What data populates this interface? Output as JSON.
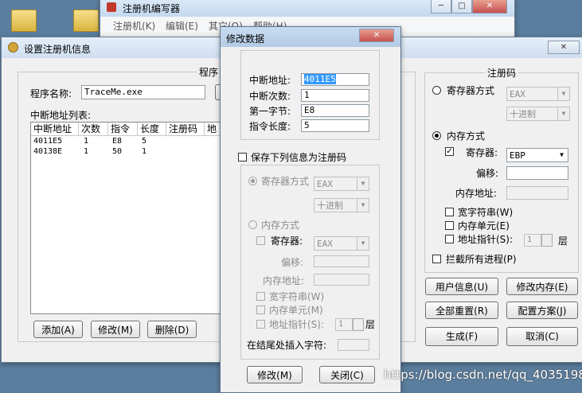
{
  "back_window": {
    "title": "注册机编写器",
    "menu": [
      "注册机(K)",
      "编辑(E)",
      "其它(O)",
      "帮助(H)"
    ]
  },
  "settings_window": {
    "title": "设置注册机信息",
    "program_group_label": "程序",
    "program_name_label": "程序名称:",
    "program_name_value": "TraceMe.exe",
    "breakpoint_list_label": "中断地址列表:",
    "table": {
      "headers": [
        "中断地址",
        "次数",
        "指令",
        "长度",
        "注册码",
        "地"
      ],
      "rows": [
        [
          "4011E5",
          "1",
          "E8",
          "5"
        ],
        [
          "40138E",
          "1",
          "50",
          "1"
        ]
      ]
    },
    "buttons": {
      "add": "添加(A)",
      "modify": "修改(M)",
      "delete": "删除(D)",
      "user_info": "用户信息(U)",
      "modify_memory": "修改内存(E)",
      "reset_all": "全部重置(R)",
      "config": "配置方案(J)",
      "generate": "生成(F)",
      "cancel": "取消(C)"
    },
    "regcode": {
      "group_title": "注册码",
      "register_mode": "寄存器方式",
      "register_select": "EAX",
      "format_select": "十进制",
      "memory_mode": "内存方式",
      "register_label": "寄存器:",
      "register_value": "EBP",
      "offset_label": "偏移:",
      "mem_addr_label": "内存地址:",
      "wide_string": "宽字符串(W)",
      "mem_unit": "内存单元(E)",
      "addr_pointer": "地址指针(S):",
      "pointer_value": "1",
      "layer_label": "层",
      "intercept_all": "拦截所有进程(P)"
    }
  },
  "modify_dialog": {
    "title": "修改数据",
    "break_addr_label": "中断地址:",
    "break_addr_value": "4011E5",
    "break_count_label": "中断次数:",
    "break_count_value": "1",
    "first_byte_label": "第一字节:",
    "first_byte_value": "E8",
    "instr_len_label": "指令长度:",
    "instr_len_value": "5",
    "save_as_regcode": "保存下列信息为注册码",
    "register_mode": "寄存器方式",
    "register_select": "EAX",
    "format_select": "十进制",
    "memory_mode": "内存方式",
    "register_label": "寄存器:",
    "register_select2": "EAX",
    "offset_label": "偏移:",
    "mem_addr_label": "内存地址:",
    "wide_string": "宽字符串(W)",
    "mem_unit": "内存单元(M)",
    "addr_pointer": "地址指针(S):",
    "pointer_value": "1",
    "layer_label": "层",
    "append_label": "在结尾处插入字符:",
    "modify_button": "修改(M)",
    "close_button": "关闭(C)"
  },
  "watermark": "https://blog.csdn.net/qq_40351988"
}
